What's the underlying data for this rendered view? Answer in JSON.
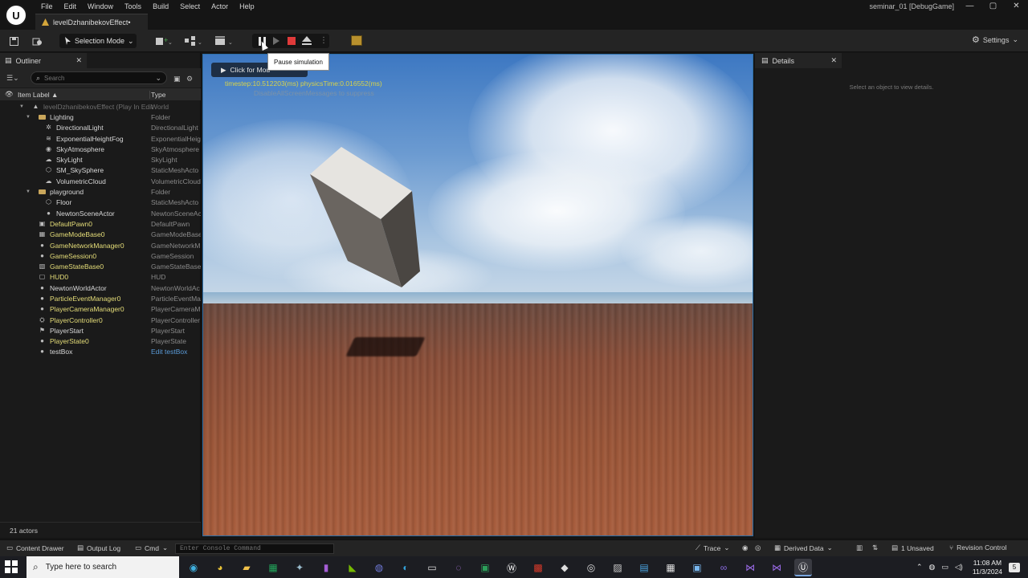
{
  "app": {
    "menus": [
      "File",
      "Edit",
      "Window",
      "Tools",
      "Build",
      "Select",
      "Actor",
      "Help"
    ],
    "project_title": "seminar_01 [DebugGame]",
    "level_tab": "levelDzhanibekovEffect•",
    "window_controls": [
      "—",
      "▢",
      "✕"
    ]
  },
  "toolbar": {
    "selection_mode": "Selection Mode",
    "settings_label": "Settings",
    "tooltip": "Pause simulation",
    "icons": [
      "save-icon",
      "content-icon",
      "add-actor-icon",
      "blueprint-icon",
      "cinematics-icon",
      "pause-icon",
      "step-icon",
      "stop-icon",
      "eject-icon",
      "more-options-icon",
      "sequencer-icon",
      "gear-icon"
    ]
  },
  "outliner": {
    "tab_label": "Outliner",
    "search_placeholder": "Search",
    "col_label": "Item Label ▲",
    "col_type": "Type",
    "status": "21 actors",
    "rows": [
      {
        "indent": 0,
        "arrow": "▼",
        "icon": "level",
        "name": "levelDzhanibekovEffect (Play In Edit",
        "type": "World",
        "style": "dim"
      },
      {
        "indent": 1,
        "arrow": "▼",
        "icon": "folder",
        "name": "Lighting",
        "type": "Folder",
        "style": ""
      },
      {
        "indent": 2,
        "arrow": "",
        "icon": "sun",
        "name": "DirectionalLight",
        "type": "DirectionalLight",
        "style": ""
      },
      {
        "indent": 2,
        "arrow": "",
        "icon": "fog",
        "name": "ExponentialHeightFog",
        "type": "ExponentialHeig",
        "style": ""
      },
      {
        "indent": 2,
        "arrow": "",
        "icon": "sky",
        "name": "SkyAtmosphere",
        "type": "SkyAtmosphere",
        "style": ""
      },
      {
        "indent": 2,
        "arrow": "",
        "icon": "skylight",
        "name": "SkyLight",
        "type": "SkyLight",
        "style": ""
      },
      {
        "indent": 2,
        "arrow": "",
        "icon": "mesh",
        "name": "SM_SkySphere",
        "type": "StaticMeshActo",
        "style": ""
      },
      {
        "indent": 2,
        "arrow": "",
        "icon": "cloud",
        "name": "VolumetricCloud",
        "type": "VolumetricCloud",
        "style": ""
      },
      {
        "indent": 1,
        "arrow": "▼",
        "icon": "folder",
        "name": "playground",
        "type": "Folder",
        "style": ""
      },
      {
        "indent": 2,
        "arrow": "",
        "icon": "mesh",
        "name": "Floor",
        "type": "StaticMeshActo",
        "style": ""
      },
      {
        "indent": 2,
        "arrow": "",
        "icon": "actor",
        "name": "NewtonSceneActor",
        "type": "NewtonSceneAc",
        "style": ""
      },
      {
        "indent": 1,
        "arrow": "",
        "icon": "pawn",
        "name": "DefaultPawn0",
        "type": "DefaultPawn",
        "style": "yellow"
      },
      {
        "indent": 1,
        "arrow": "",
        "icon": "gamemode",
        "name": "GameModeBase0",
        "type": "GameModeBase",
        "style": "yellow"
      },
      {
        "indent": 1,
        "arrow": "",
        "icon": "actor",
        "name": "GameNetworkManager0",
        "type": "GameNetworkM",
        "style": "yellow"
      },
      {
        "indent": 1,
        "arrow": "",
        "icon": "actor",
        "name": "GameSession0",
        "type": "GameSession",
        "style": "yellow"
      },
      {
        "indent": 1,
        "arrow": "",
        "icon": "gamestate",
        "name": "GameStateBase0",
        "type": "GameStateBase",
        "style": "yellow"
      },
      {
        "indent": 1,
        "arrow": "",
        "icon": "hud",
        "name": "HUD0",
        "type": "HUD",
        "style": "yellow"
      },
      {
        "indent": 1,
        "arrow": "",
        "icon": "actor",
        "name": "NewtonWorldActor",
        "type": "NewtonWorldAc",
        "style": ""
      },
      {
        "indent": 1,
        "arrow": "",
        "icon": "actor",
        "name": "ParticleEventManager0",
        "type": "ParticleEventMa",
        "style": "yellow"
      },
      {
        "indent": 1,
        "arrow": "",
        "icon": "actor",
        "name": "PlayerCameraManager0",
        "type": "PlayerCameraM",
        "style": "yellow"
      },
      {
        "indent": 1,
        "arrow": "",
        "icon": "controller",
        "name": "PlayerController0",
        "type": "PlayerController",
        "style": "yellow"
      },
      {
        "indent": 1,
        "arrow": "",
        "icon": "start",
        "name": "PlayerStart",
        "type": "PlayerStart",
        "style": ""
      },
      {
        "indent": 1,
        "arrow": "",
        "icon": "actor",
        "name": "PlayerState0",
        "type": "PlayerState",
        "style": "yellow"
      },
      {
        "indent": 1,
        "arrow": "",
        "icon": "actor",
        "name": "testBox",
        "type": "Edit testBox",
        "style": "link"
      }
    ]
  },
  "viewport": {
    "click_hint": "Click for Mou",
    "stats_line": "timestep:10.512203(ms)  physicsTime:0.016552(ms)",
    "stats_line2": "DisableAllScreenMessages  to suppress"
  },
  "details": {
    "tab_label": "Details",
    "empty_text": "Select an object to view details."
  },
  "statusbar": {
    "content_drawer": "Content Drawer",
    "output_log": "Output Log",
    "cmd": "Cmd",
    "console_placeholder": "Enter Console Command",
    "trace": "Trace",
    "derived_data": "Derived Data",
    "unsaved": "1 Unsaved",
    "revision_control": "Revision Control"
  },
  "taskbar": {
    "search_placeholder": "Type here to search",
    "time": "11:08 AM",
    "date": "11/3/2024",
    "notifications": "5"
  }
}
